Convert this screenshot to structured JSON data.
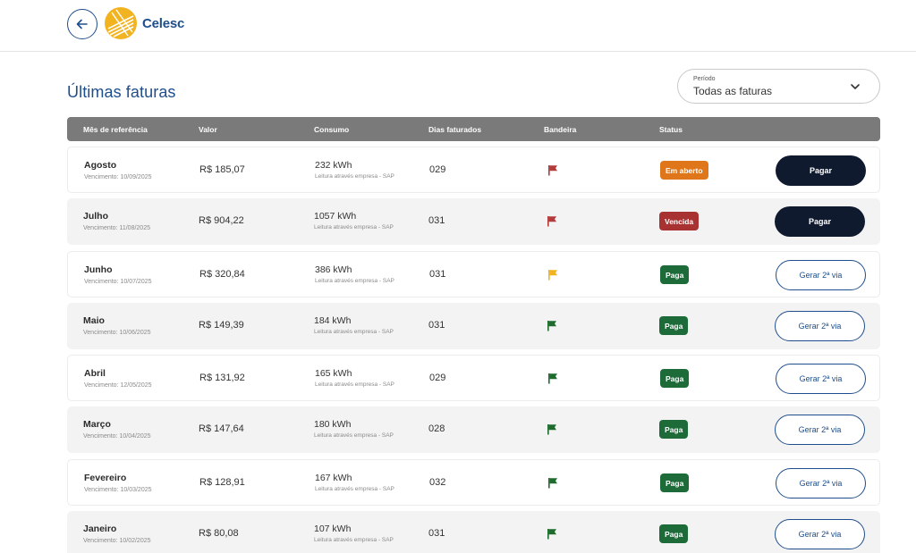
{
  "header": {
    "logo_text": "Celesc",
    "back_icon": "arrow-left-icon"
  },
  "page": {
    "title": "Últimas faturas"
  },
  "period": {
    "label": "Período",
    "value": "Todas as faturas",
    "icon": "chevron-down-icon"
  },
  "table": {
    "headers": {
      "month": "Mês de referência",
      "value": "Valor",
      "consumption": "Consumo",
      "days": "Dias faturados",
      "flag": "Bandeira",
      "status": "Status"
    },
    "rows": [
      {
        "month": "Agosto",
        "due": "Vencimento: 10/09/2025",
        "value": "R$ 185,07",
        "consumption": "232 kWh",
        "reading": "Leitura através empresa - SAP",
        "days": "029",
        "flag_color": "#b23b3b",
        "status": "Em aberto",
        "status_color": "#e0761a",
        "action": "Pagar",
        "action_type": "pay"
      },
      {
        "month": "Julho",
        "due": "Vencimento: 11/08/2025",
        "value": "R$ 904,22",
        "consumption": "1057 kWh",
        "reading": "Leitura através empresa - SAP",
        "days": "031",
        "flag_color": "#b23b3b",
        "status": "Vencida",
        "status_color": "#a83232",
        "action": "Pagar",
        "action_type": "pay"
      },
      {
        "month": "Junho",
        "due": "Vencimento: 10/07/2025",
        "value": "R$ 320,84",
        "consumption": "386 kWh",
        "reading": "Leitura através empresa - SAP",
        "days": "031",
        "flag_color": "#f2b320",
        "status": "Paga",
        "status_color": "#1e6b3a",
        "action": "Gerar 2ª via",
        "action_type": "gen"
      },
      {
        "month": "Maio",
        "due": "Vencimento: 10/06/2025",
        "value": "R$ 149,39",
        "consumption": "184 kWh",
        "reading": "Leitura através empresa - SAP",
        "days": "031",
        "flag_color": "#1e6b2e",
        "status": "Paga",
        "status_color": "#1e6b3a",
        "action": "Gerar 2ª via",
        "action_type": "gen"
      },
      {
        "month": "Abril",
        "due": "Vencimento: 12/05/2025",
        "value": "R$ 131,92",
        "consumption": "165 kWh",
        "reading": "Leitura através empresa - SAP",
        "days": "029",
        "flag_color": "#1e6b2e",
        "status": "Paga",
        "status_color": "#1e6b3a",
        "action": "Gerar 2ª via",
        "action_type": "gen"
      },
      {
        "month": "Março",
        "due": "Vencimento: 10/04/2025",
        "value": "R$ 147,64",
        "consumption": "180 kWh",
        "reading": "Leitura através empresa - SAP",
        "days": "028",
        "flag_color": "#1e6b2e",
        "status": "Paga",
        "status_color": "#1e6b3a",
        "action": "Gerar 2ª via",
        "action_type": "gen"
      },
      {
        "month": "Fevereiro",
        "due": "Vencimento: 10/03/2025",
        "value": "R$ 128,91",
        "consumption": "167 kWh",
        "reading": "Leitura através empresa - SAP",
        "days": "032",
        "flag_color": "#1e6b2e",
        "status": "Paga",
        "status_color": "#1e6b3a",
        "action": "Gerar 2ª via",
        "action_type": "gen"
      },
      {
        "month": "Janeiro",
        "due": "Vencimento: 10/02/2025",
        "value": "R$ 80,08",
        "consumption": "107 kWh",
        "reading": "Leitura através empresa - SAP",
        "days": "031",
        "flag_color": "#1e6b2e",
        "status": "Paga",
        "status_color": "#1e6b3a",
        "action": "Gerar 2ª via",
        "action_type": "gen"
      }
    ]
  }
}
